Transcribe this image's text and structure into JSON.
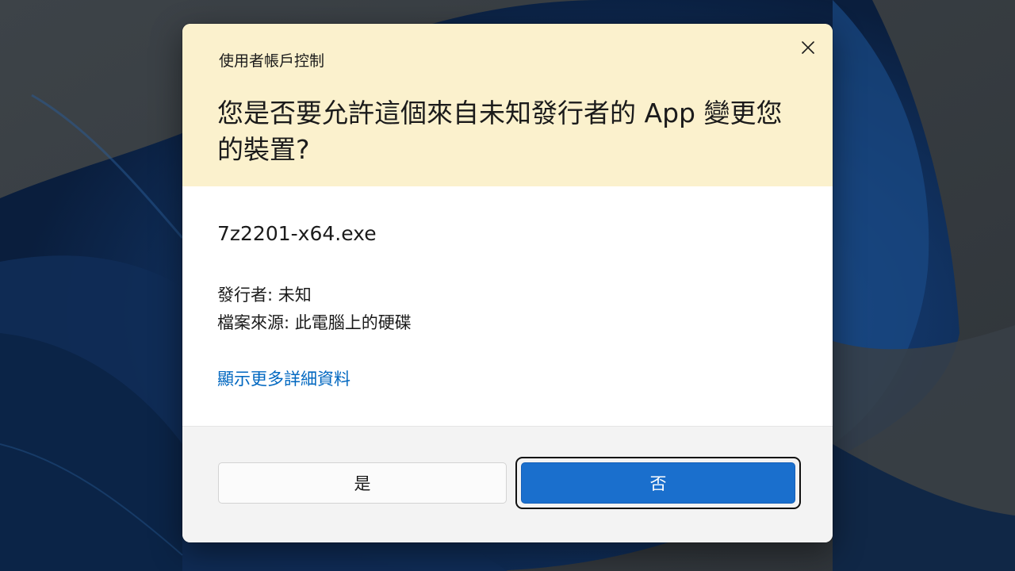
{
  "colors": {
    "header_background": "#fbf1cd",
    "primary_button": "#1a6fcd",
    "link": "#0067c0",
    "footer_background": "#f3f3f3"
  },
  "dialog": {
    "window_title": "使用者帳戶控制",
    "close_icon": "close-icon",
    "headline": "您是否要允許這個來自未知發行者的 App 變更您的裝置?",
    "file_name": "7z2201-x64.exe",
    "publisher_line": "發行者: 未知",
    "origin_line": "檔案來源: 此電腦上的硬碟",
    "details_link": "顯示更多詳細資料",
    "buttons": {
      "yes": "是",
      "no": "否"
    }
  }
}
